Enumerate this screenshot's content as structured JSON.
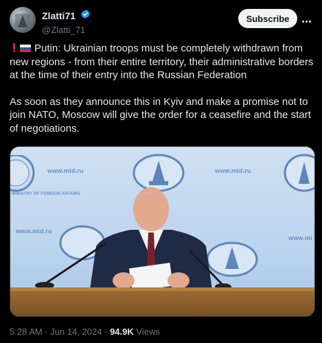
{
  "author": {
    "display_name": "Zlatti71",
    "handle": "@Zlatti_71",
    "verified_icon": "verified-badge-icon",
    "avatar_icon": "avatar-image"
  },
  "actions": {
    "subscribe_label": "Subscribe",
    "more_icon": "more-options-icon"
  },
  "post": {
    "paragraph1": "Putin: Ukrainian troops must be completely withdrawn from new regions - from their entire territory, their administrative borders at the time of their entry into the Russian Federation",
    "paragraph2": "As soon as they announce this in Kyiv and make a promise not to join NATO, Moscow will give the order for a ceasefire and the start of negotiations.",
    "emoji": [
      "exclamation-icon",
      "russian-flag-icon"
    ]
  },
  "media": {
    "wall_text": [
      "www.mid.ru",
      "www.mid.ru",
      "www.mi",
      "www.mid.ru"
    ]
  },
  "meta": {
    "time": "5:28 AM",
    "separator": "·",
    "date": "Jun 14, 2024",
    "views_count": "94.9K",
    "views_label": "Views"
  },
  "colors": {
    "background": "#000000",
    "text": "#e7e9ea",
    "secondary": "#71767b",
    "verified": "#1d9bf0",
    "button_bg": "#eff3f4"
  }
}
